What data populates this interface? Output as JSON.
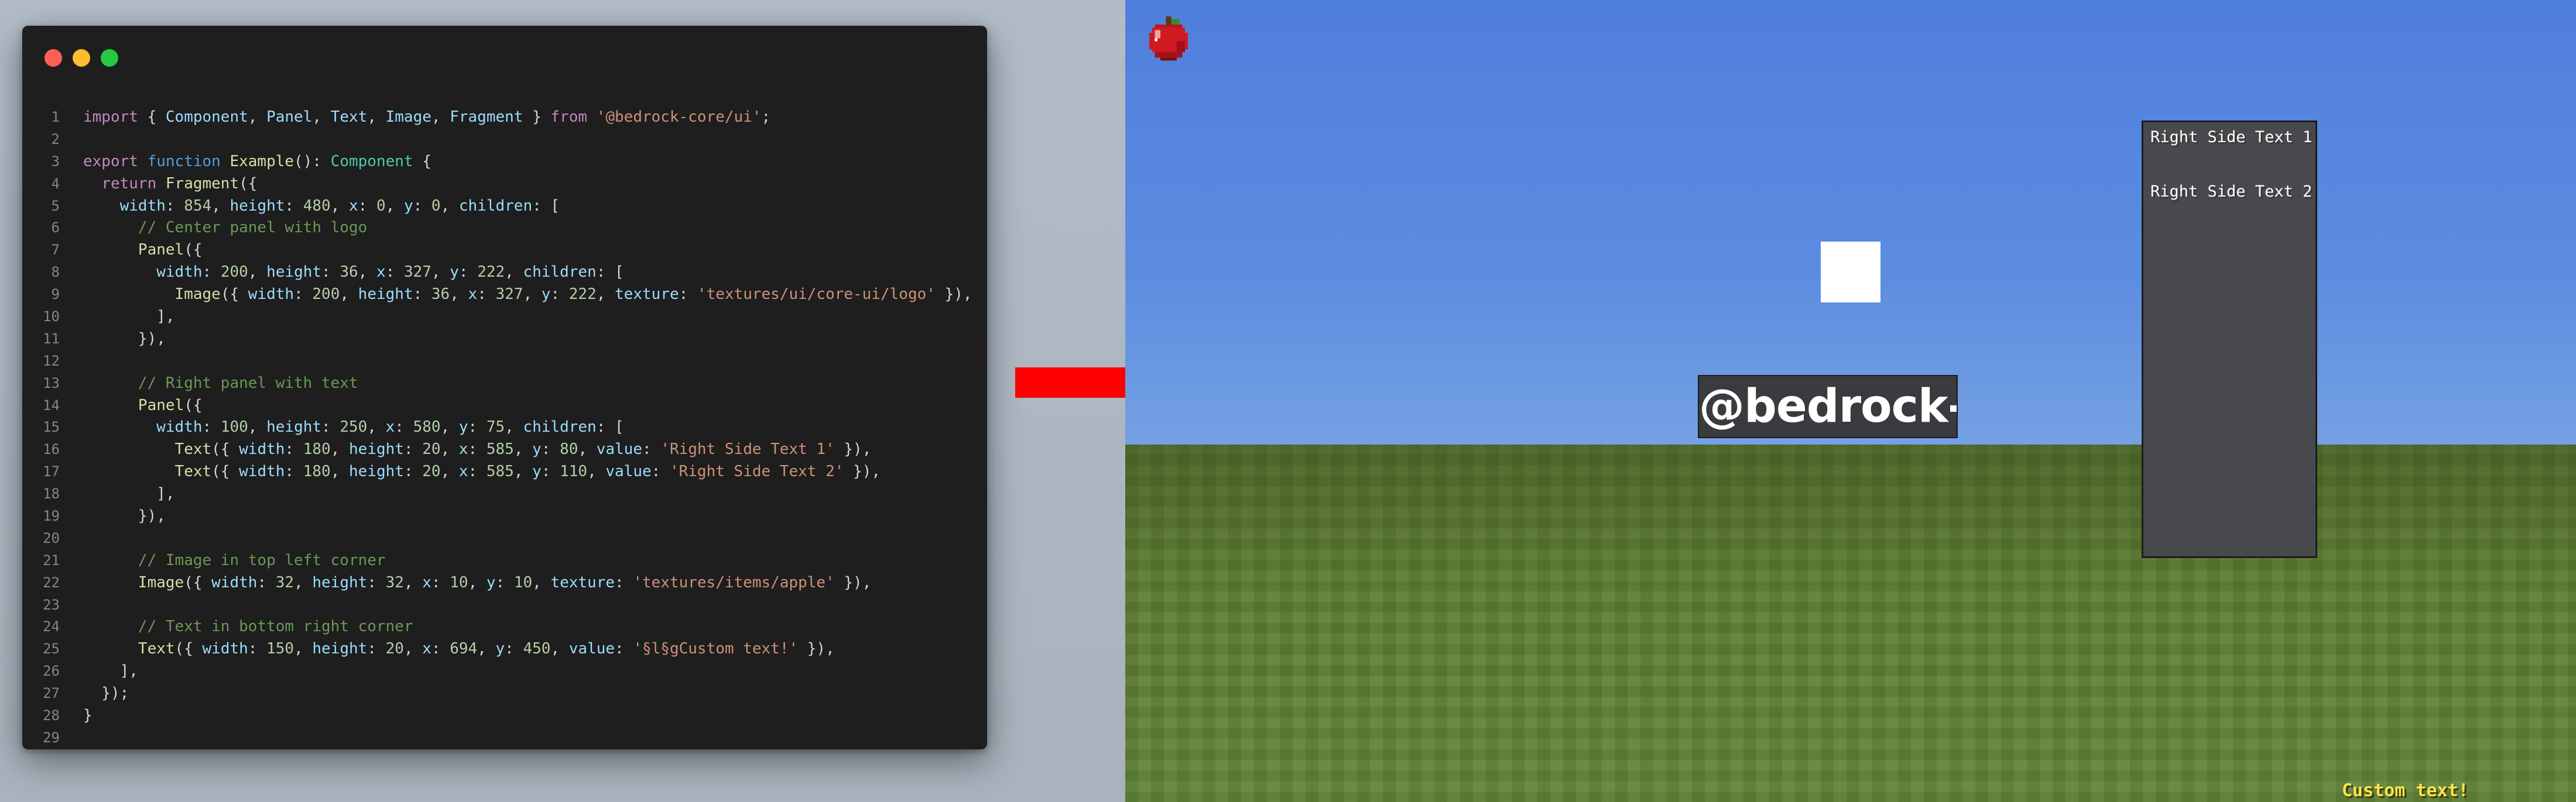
{
  "code_window": {
    "lines": [
      {
        "num": "1",
        "tokens": [
          {
            "t": "import",
            "c": "kw"
          },
          {
            "t": " { ",
            "c": ""
          },
          {
            "t": "Component",
            "c": "pr"
          },
          {
            "t": ", ",
            "c": ""
          },
          {
            "t": "Panel",
            "c": "pr"
          },
          {
            "t": ", ",
            "c": ""
          },
          {
            "t": "Text",
            "c": "pr"
          },
          {
            "t": ", ",
            "c": ""
          },
          {
            "t": "Image",
            "c": "pr"
          },
          {
            "t": ", ",
            "c": ""
          },
          {
            "t": "Fragment",
            "c": "pr"
          },
          {
            "t": " } ",
            "c": ""
          },
          {
            "t": "from",
            "c": "kw"
          },
          {
            "t": " ",
            "c": ""
          },
          {
            "t": "'@bedrock-core/ui'",
            "c": "st"
          },
          {
            "t": ";",
            "c": ""
          }
        ]
      },
      {
        "num": "2",
        "tokens": []
      },
      {
        "num": "3",
        "tokens": [
          {
            "t": "export",
            "c": "kw"
          },
          {
            "t": " ",
            "c": ""
          },
          {
            "t": "function",
            "c": "kwb"
          },
          {
            "t": " ",
            "c": ""
          },
          {
            "t": "Example",
            "c": "fn"
          },
          {
            "t": "(): ",
            "c": ""
          },
          {
            "t": "Component",
            "c": "ty"
          },
          {
            "t": " {",
            "c": ""
          }
        ]
      },
      {
        "num": "4",
        "tokens": [
          {
            "t": "  ",
            "c": ""
          },
          {
            "t": "return",
            "c": "kw"
          },
          {
            "t": " ",
            "c": ""
          },
          {
            "t": "Fragment",
            "c": "fn"
          },
          {
            "t": "({",
            "c": ""
          }
        ]
      },
      {
        "num": "5",
        "tokens": [
          {
            "t": "    ",
            "c": ""
          },
          {
            "t": "width",
            "c": "pr"
          },
          {
            "t": ": ",
            "c": ""
          },
          {
            "t": "854",
            "c": "nu"
          },
          {
            "t": ", ",
            "c": ""
          },
          {
            "t": "height",
            "c": "pr"
          },
          {
            "t": ": ",
            "c": ""
          },
          {
            "t": "480",
            "c": "nu"
          },
          {
            "t": ", ",
            "c": ""
          },
          {
            "t": "x",
            "c": "pr"
          },
          {
            "t": ": ",
            "c": ""
          },
          {
            "t": "0",
            "c": "nu"
          },
          {
            "t": ", ",
            "c": ""
          },
          {
            "t": "y",
            "c": "pr"
          },
          {
            "t": ": ",
            "c": ""
          },
          {
            "t": "0",
            "c": "nu"
          },
          {
            "t": ", ",
            "c": ""
          },
          {
            "t": "children",
            "c": "pr"
          },
          {
            "t": ": [",
            "c": ""
          }
        ]
      },
      {
        "num": "6",
        "tokens": [
          {
            "t": "      ",
            "c": ""
          },
          {
            "t": "// Center panel with logo",
            "c": "cm"
          }
        ]
      },
      {
        "num": "7",
        "tokens": [
          {
            "t": "      ",
            "c": ""
          },
          {
            "t": "Panel",
            "c": "fn"
          },
          {
            "t": "({",
            "c": ""
          }
        ]
      },
      {
        "num": "8",
        "tokens": [
          {
            "t": "        ",
            "c": ""
          },
          {
            "t": "width",
            "c": "pr"
          },
          {
            "t": ": ",
            "c": ""
          },
          {
            "t": "200",
            "c": "nu"
          },
          {
            "t": ", ",
            "c": ""
          },
          {
            "t": "height",
            "c": "pr"
          },
          {
            "t": ": ",
            "c": ""
          },
          {
            "t": "36",
            "c": "nu"
          },
          {
            "t": ", ",
            "c": ""
          },
          {
            "t": "x",
            "c": "pr"
          },
          {
            "t": ": ",
            "c": ""
          },
          {
            "t": "327",
            "c": "nu"
          },
          {
            "t": ", ",
            "c": ""
          },
          {
            "t": "y",
            "c": "pr"
          },
          {
            "t": ": ",
            "c": ""
          },
          {
            "t": "222",
            "c": "nu"
          },
          {
            "t": ", ",
            "c": ""
          },
          {
            "t": "children",
            "c": "pr"
          },
          {
            "t": ": [",
            "c": ""
          }
        ]
      },
      {
        "num": "9",
        "tokens": [
          {
            "t": "          ",
            "c": ""
          },
          {
            "t": "Image",
            "c": "fn"
          },
          {
            "t": "({ ",
            "c": ""
          },
          {
            "t": "width",
            "c": "pr"
          },
          {
            "t": ": ",
            "c": ""
          },
          {
            "t": "200",
            "c": "nu"
          },
          {
            "t": ", ",
            "c": ""
          },
          {
            "t": "height",
            "c": "pr"
          },
          {
            "t": ": ",
            "c": ""
          },
          {
            "t": "36",
            "c": "nu"
          },
          {
            "t": ", ",
            "c": ""
          },
          {
            "t": "x",
            "c": "pr"
          },
          {
            "t": ": ",
            "c": ""
          },
          {
            "t": "327",
            "c": "nu"
          },
          {
            "t": ", ",
            "c": ""
          },
          {
            "t": "y",
            "c": "pr"
          },
          {
            "t": ": ",
            "c": ""
          },
          {
            "t": "222",
            "c": "nu"
          },
          {
            "t": ", ",
            "c": ""
          },
          {
            "t": "texture",
            "c": "pr"
          },
          {
            "t": ": ",
            "c": ""
          },
          {
            "t": "'textures/ui/core-ui/logo'",
            "c": "st"
          },
          {
            "t": " }),",
            "c": ""
          }
        ]
      },
      {
        "num": "10",
        "tokens": [
          {
            "t": "        ],",
            "c": ""
          }
        ]
      },
      {
        "num": "11",
        "tokens": [
          {
            "t": "      }),",
            "c": ""
          }
        ]
      },
      {
        "num": "12",
        "tokens": []
      },
      {
        "num": "13",
        "tokens": [
          {
            "t": "      ",
            "c": ""
          },
          {
            "t": "// Right panel with text",
            "c": "cm"
          }
        ]
      },
      {
        "num": "14",
        "tokens": [
          {
            "t": "      ",
            "c": ""
          },
          {
            "t": "Panel",
            "c": "fn"
          },
          {
            "t": "({",
            "c": ""
          }
        ]
      },
      {
        "num": "15",
        "tokens": [
          {
            "t": "        ",
            "c": ""
          },
          {
            "t": "width",
            "c": "pr"
          },
          {
            "t": ": ",
            "c": ""
          },
          {
            "t": "100",
            "c": "nu"
          },
          {
            "t": ", ",
            "c": ""
          },
          {
            "t": "height",
            "c": "pr"
          },
          {
            "t": ": ",
            "c": ""
          },
          {
            "t": "250",
            "c": "nu"
          },
          {
            "t": ", ",
            "c": ""
          },
          {
            "t": "x",
            "c": "pr"
          },
          {
            "t": ": ",
            "c": ""
          },
          {
            "t": "580",
            "c": "nu"
          },
          {
            "t": ", ",
            "c": ""
          },
          {
            "t": "y",
            "c": "pr"
          },
          {
            "t": ": ",
            "c": ""
          },
          {
            "t": "75",
            "c": "nu"
          },
          {
            "t": ", ",
            "c": ""
          },
          {
            "t": "children",
            "c": "pr"
          },
          {
            "t": ": [",
            "c": ""
          }
        ]
      },
      {
        "num": "16",
        "tokens": [
          {
            "t": "          ",
            "c": ""
          },
          {
            "t": "Text",
            "c": "fn"
          },
          {
            "t": "({ ",
            "c": ""
          },
          {
            "t": "width",
            "c": "pr"
          },
          {
            "t": ": ",
            "c": ""
          },
          {
            "t": "180",
            "c": "nu"
          },
          {
            "t": ", ",
            "c": ""
          },
          {
            "t": "height",
            "c": "pr"
          },
          {
            "t": ": ",
            "c": ""
          },
          {
            "t": "20",
            "c": "nu"
          },
          {
            "t": ", ",
            "c": ""
          },
          {
            "t": "x",
            "c": "pr"
          },
          {
            "t": ": ",
            "c": ""
          },
          {
            "t": "585",
            "c": "nu"
          },
          {
            "t": ", ",
            "c": ""
          },
          {
            "t": "y",
            "c": "pr"
          },
          {
            "t": ": ",
            "c": ""
          },
          {
            "t": "80",
            "c": "nu"
          },
          {
            "t": ", ",
            "c": ""
          },
          {
            "t": "value",
            "c": "pr"
          },
          {
            "t": ": ",
            "c": ""
          },
          {
            "t": "'Right Side Text 1'",
            "c": "st"
          },
          {
            "t": " }),",
            "c": ""
          }
        ]
      },
      {
        "num": "17",
        "tokens": [
          {
            "t": "          ",
            "c": ""
          },
          {
            "t": "Text",
            "c": "fn"
          },
          {
            "t": "({ ",
            "c": ""
          },
          {
            "t": "width",
            "c": "pr"
          },
          {
            "t": ": ",
            "c": ""
          },
          {
            "t": "180",
            "c": "nu"
          },
          {
            "t": ", ",
            "c": ""
          },
          {
            "t": "height",
            "c": "pr"
          },
          {
            "t": ": ",
            "c": ""
          },
          {
            "t": "20",
            "c": "nu"
          },
          {
            "t": ", ",
            "c": ""
          },
          {
            "t": "x",
            "c": "pr"
          },
          {
            "t": ": ",
            "c": ""
          },
          {
            "t": "585",
            "c": "nu"
          },
          {
            "t": ", ",
            "c": ""
          },
          {
            "t": "y",
            "c": "pr"
          },
          {
            "t": ": ",
            "c": ""
          },
          {
            "t": "110",
            "c": "nu"
          },
          {
            "t": ", ",
            "c": ""
          },
          {
            "t": "value",
            "c": "pr"
          },
          {
            "t": ": ",
            "c": ""
          },
          {
            "t": "'Right Side Text 2'",
            "c": "st"
          },
          {
            "t": " }),",
            "c": ""
          }
        ]
      },
      {
        "num": "18",
        "tokens": [
          {
            "t": "        ],",
            "c": ""
          }
        ]
      },
      {
        "num": "19",
        "tokens": [
          {
            "t": "      }),",
            "c": ""
          }
        ]
      },
      {
        "num": "20",
        "tokens": []
      },
      {
        "num": "21",
        "tokens": [
          {
            "t": "      ",
            "c": ""
          },
          {
            "t": "// Image in top left corner",
            "c": "cm"
          }
        ]
      },
      {
        "num": "22",
        "tokens": [
          {
            "t": "      ",
            "c": ""
          },
          {
            "t": "Image",
            "c": "fn"
          },
          {
            "t": "({ ",
            "c": ""
          },
          {
            "t": "width",
            "c": "pr"
          },
          {
            "t": ": ",
            "c": ""
          },
          {
            "t": "32",
            "c": "nu"
          },
          {
            "t": ", ",
            "c": ""
          },
          {
            "t": "height",
            "c": "pr"
          },
          {
            "t": ": ",
            "c": ""
          },
          {
            "t": "32",
            "c": "nu"
          },
          {
            "t": ", ",
            "c": ""
          },
          {
            "t": "x",
            "c": "pr"
          },
          {
            "t": ": ",
            "c": ""
          },
          {
            "t": "10",
            "c": "nu"
          },
          {
            "t": ", ",
            "c": ""
          },
          {
            "t": "y",
            "c": "pr"
          },
          {
            "t": ": ",
            "c": ""
          },
          {
            "t": "10",
            "c": "nu"
          },
          {
            "t": ", ",
            "c": ""
          },
          {
            "t": "texture",
            "c": "pr"
          },
          {
            "t": ": ",
            "c": ""
          },
          {
            "t": "'textures/items/apple'",
            "c": "st"
          },
          {
            "t": " }),",
            "c": ""
          }
        ]
      },
      {
        "num": "23",
        "tokens": []
      },
      {
        "num": "24",
        "tokens": [
          {
            "t": "      ",
            "c": ""
          },
          {
            "t": "// Text in bottom right corner",
            "c": "cm"
          }
        ]
      },
      {
        "num": "25",
        "tokens": [
          {
            "t": "      ",
            "c": ""
          },
          {
            "t": "Text",
            "c": "fn"
          },
          {
            "t": "({ ",
            "c": ""
          },
          {
            "t": "width",
            "c": "pr"
          },
          {
            "t": ": ",
            "c": ""
          },
          {
            "t": "150",
            "c": "nu"
          },
          {
            "t": ", ",
            "c": ""
          },
          {
            "t": "height",
            "c": "pr"
          },
          {
            "t": ": ",
            "c": ""
          },
          {
            "t": "20",
            "c": "nu"
          },
          {
            "t": ", ",
            "c": ""
          },
          {
            "t": "x",
            "c": "pr"
          },
          {
            "t": ": ",
            "c": ""
          },
          {
            "t": "694",
            "c": "nu"
          },
          {
            "t": ", ",
            "c": ""
          },
          {
            "t": "y",
            "c": "pr"
          },
          {
            "t": ": ",
            "c": ""
          },
          {
            "t": "450",
            "c": "nu"
          },
          {
            "t": ", ",
            "c": ""
          },
          {
            "t": "value",
            "c": "pr"
          },
          {
            "t": ": ",
            "c": ""
          },
          {
            "t": "'§l§gCustom text!'",
            "c": "st"
          },
          {
            "t": " }),",
            "c": ""
          }
        ]
      },
      {
        "num": "26",
        "tokens": [
          {
            "t": "    ],",
            "c": ""
          }
        ]
      },
      {
        "num": "27",
        "tokens": [
          {
            "t": "  });",
            "c": ""
          }
        ]
      },
      {
        "num": "28",
        "tokens": [
          {
            "t": "}",
            "c": ""
          }
        ]
      },
      {
        "num": "29",
        "tokens": []
      }
    ]
  },
  "arrow": {
    "color": "#ff0000"
  },
  "game": {
    "apple_icon": "apple-icon",
    "logo_text": "@bedrock-core",
    "right_panel": {
      "text_1": "Right Side Text 1",
      "text_2": "Right Side Text 2"
    },
    "custom_text": "Custom text!",
    "custom_text_color": "#f6e54a"
  }
}
